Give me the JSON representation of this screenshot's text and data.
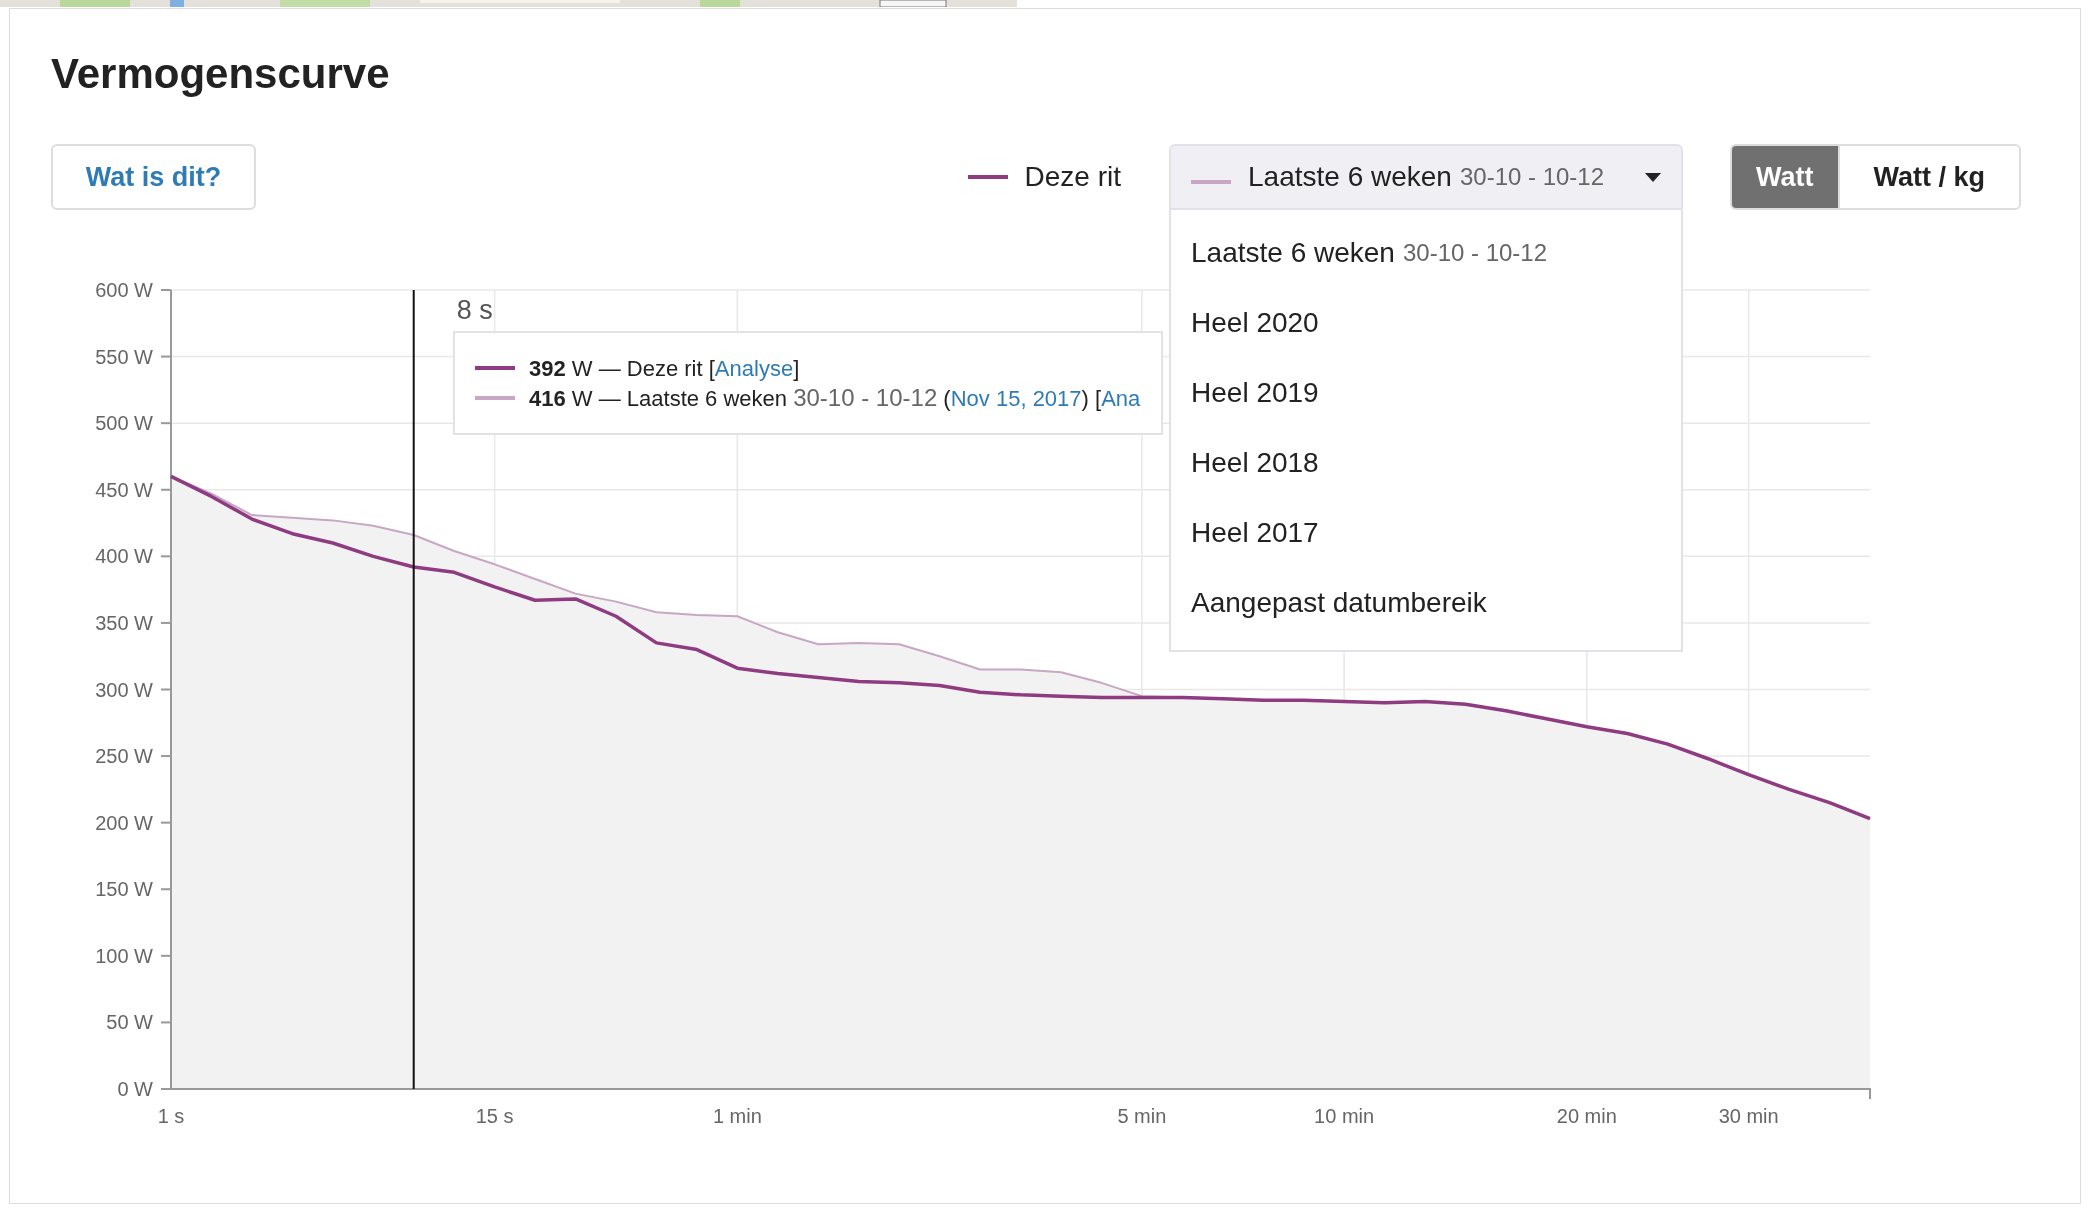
{
  "title": "Vermogenscurve",
  "help_button": "Wat is dit?",
  "legend": {
    "label": "Deze rit",
    "color": "#8e3b82"
  },
  "period_select": {
    "label": "Laatste 6 weken",
    "range": "30-10 - 10-12",
    "color": "#c9a6c4",
    "expanded": true,
    "options": [
      {
        "label": "Laatste 6 weken",
        "range": "30-10 - 10-12"
      },
      {
        "label": "Heel 2020"
      },
      {
        "label": "Heel 2019"
      },
      {
        "label": "Heel 2018"
      },
      {
        "label": "Heel 2017"
      },
      {
        "label": "Aangepast datumbereik"
      }
    ]
  },
  "unit_toggle": [
    {
      "label": "Watt",
      "selected": true
    },
    {
      "label": "Watt / kg",
      "selected": false
    }
  ],
  "tooltip": [
    {
      "color": "#8e3b82",
      "parts": [
        {
          "kind": "text",
          "text": "**392** W — Deze rit ["
        },
        {
          "kind": "link",
          "text": "Analyse"
        },
        {
          "kind": "text",
          "text": "]"
        }
      ]
    },
    {
      "color": "#c9a6c4",
      "parts": [
        {
          "kind": "text",
          "text": "**416** W — Laatste 6 weken "
        },
        {
          "kind": "muted",
          "text": "30-10 - 10-12"
        },
        {
          "kind": "text",
          "text": " ("
        },
        {
          "kind": "link",
          "text": "Nov 15, 2017"
        },
        {
          "kind": "text",
          "text": ") ["
        },
        {
          "kind": "link",
          "text": "Ana"
        }
      ]
    }
  ],
  "chart_data": {
    "type": "line",
    "grid": true,
    "categories": [
      "1 s",
      null,
      null,
      null,
      null,
      null,
      null,
      null,
      "15 s",
      null,
      null,
      null,
      null,
      null,
      "1 min",
      null,
      null,
      null,
      null,
      null,
      null,
      null,
      null,
      null,
      "5 min",
      null,
      null,
      null,
      null,
      "10 min",
      null,
      null,
      null,
      null,
      null,
      "20 min",
      null,
      null,
      null,
      "30 min",
      null,
      null,
      null
    ],
    "series": [
      {
        "color": "#8e3b82",
        "values": [
          460,
          445,
          428,
          417,
          410,
          400,
          392,
          388,
          377,
          367,
          368,
          355,
          335,
          330,
          316,
          312,
          309,
          306,
          305,
          303,
          298,
          296,
          295,
          294,
          294,
          294,
          293,
          292,
          292,
          291,
          290,
          291,
          289,
          284,
          278,
          272,
          267,
          259,
          248,
          236,
          225,
          215,
          203
        ]
      },
      {
        "color": "#c9a6c4",
        "type": "area",
        "values": [
          460,
          447,
          431,
          429,
          427,
          423,
          416,
          404,
          394,
          383,
          372,
          366,
          358,
          356,
          355,
          343,
          334,
          335,
          334,
          325,
          315,
          315,
          313,
          305,
          295,
          294,
          293,
          292,
          292,
          291,
          290,
          291,
          289,
          284,
          278,
          272,
          267,
          259,
          248,
          236,
          225,
          215,
          203
        ]
      }
    ],
    "ylim": [
      0,
      600
    ],
    "yticks": [
      {
        "value": 0,
        "label": "0 W"
      },
      {
        "value": 50,
        "label": "50 W"
      },
      {
        "value": 100,
        "label": "100 W"
      },
      {
        "value": 150,
        "label": "150 W"
      },
      {
        "value": 200,
        "label": "200 W"
      },
      {
        "value": 250,
        "label": "250 W"
      },
      {
        "value": 300,
        "label": "300 W"
      },
      {
        "value": 350,
        "label": "350 W"
      },
      {
        "value": 400,
        "label": "400 W"
      },
      {
        "value": 450,
        "label": "450 W"
      },
      {
        "value": 500,
        "label": "500 W"
      },
      {
        "value": 550,
        "label": "550 W"
      },
      {
        "value": 600,
        "label": "600 W"
      }
    ],
    "annotations": [
      "8 s"
    ]
  }
}
